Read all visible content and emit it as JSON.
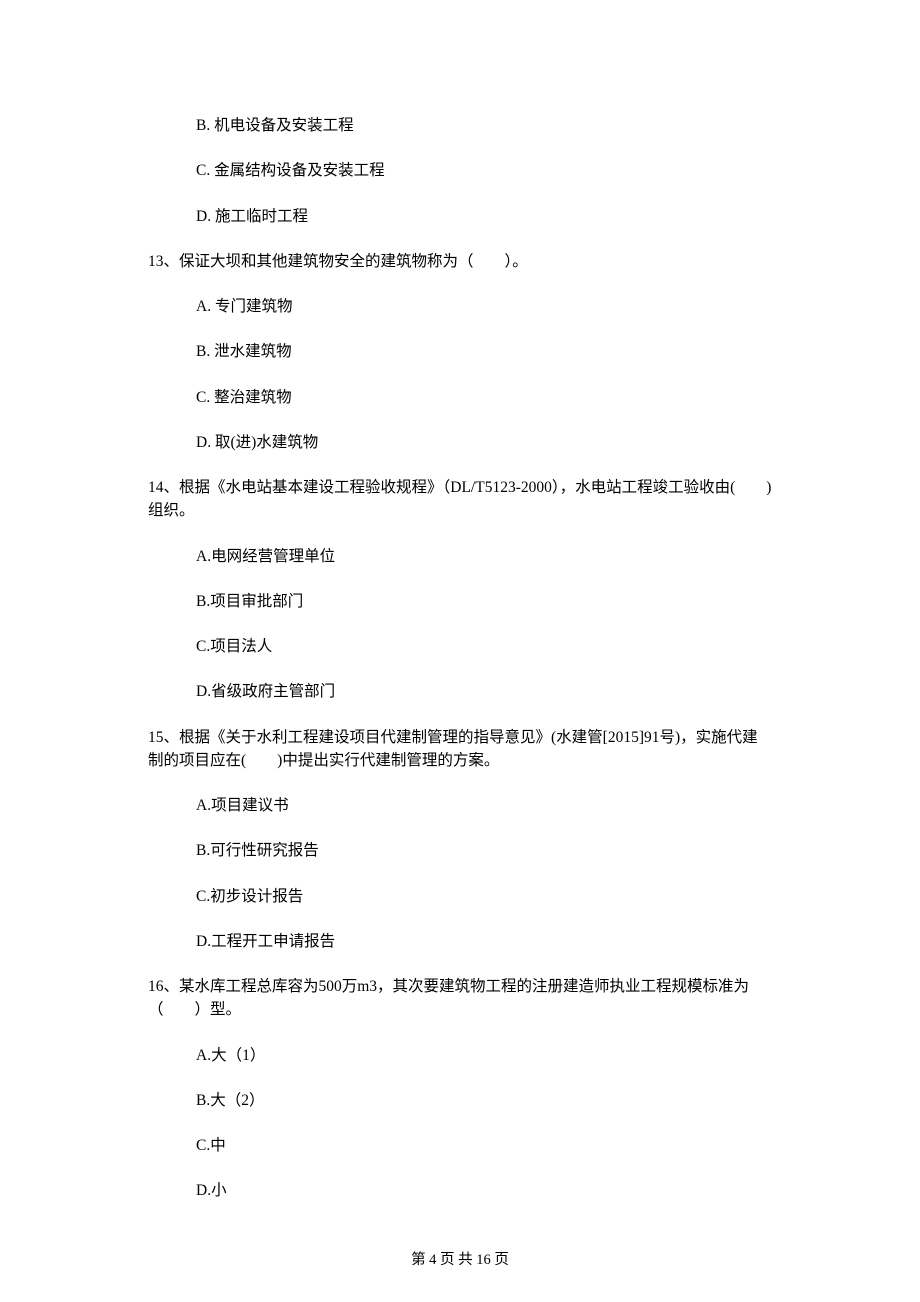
{
  "options_top": {
    "b": "B. 机电设备及安装工程",
    "c": "C. 金属结构设备及安装工程",
    "d": "D. 施工临时工程"
  },
  "q13": {
    "stem": "13、保证大坝和其他建筑物安全的建筑物称为（　　）。",
    "a": "A. 专门建筑物",
    "b": "B. 泄水建筑物",
    "c": "C. 整治建筑物",
    "d": "D. 取(进)水建筑物"
  },
  "q14": {
    "stem": "14、根据《水电站基本建设工程验收规程》（DL/T5123-2000），水电站工程竣工验收由(　　)组织。",
    "a": "A.电网经营管理单位",
    "b": "B.项目审批部门",
    "c": "C.项目法人",
    "d": "D.省级政府主管部门"
  },
  "q15": {
    "stem": "15、根据《关于水利工程建设项目代建制管理的指导意见》(水建管[2015]91号)，实施代建制的项目应在(　　)中提出实行代建制管理的方案。",
    "a": "A.项目建议书",
    "b": "B.可行性研究报告",
    "c": "C.初步设计报告",
    "d": "D.工程开工申请报告"
  },
  "q16": {
    "stem": "16、某水库工程总库容为500万m3，其次要建筑物工程的注册建造师执业工程规模标准为（　　）型。",
    "a": "A.大（1）",
    "b": "B.大（2）",
    "c": "C.中",
    "d": "D.小"
  },
  "footer": "第 4 页 共 16 页"
}
